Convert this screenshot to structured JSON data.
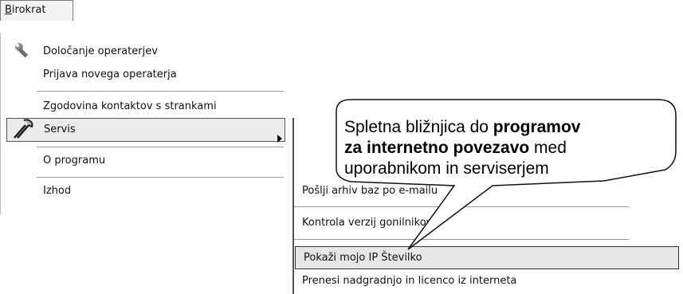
{
  "menubar": {
    "menu_title_first": "B",
    "menu_title_rest": "irokrat"
  },
  "menu": {
    "items": [
      {
        "label": "Določanje operaterjev",
        "icon": "wrench-icon"
      },
      {
        "label": "Prijava novega operaterja"
      },
      {
        "label": "Zgodovina kontaktov s strankami"
      },
      {
        "label": "Servis",
        "icon": "tools-icon",
        "selected": true,
        "has_submenu": true
      },
      {
        "label": "O programu"
      },
      {
        "label": "Izhod"
      }
    ]
  },
  "submenu": {
    "items": [
      {
        "label": "Pošlji arhiv baz po e-mailu"
      },
      {
        "label": "Kontrola verzij gonilnikov"
      },
      {
        "label": "Pokaži mojo IP Številko",
        "selected": true
      },
      {
        "label": "Prenesi nadgradnjo in licenco iz interneta"
      }
    ]
  },
  "callout": {
    "line1_a": "Spletna bližnjica do ",
    "line1_b": "programov",
    "line2_a": "za internetno  povezavo",
    "line2_b": " med",
    "line3": "uporabnikom in serviserjem"
  }
}
